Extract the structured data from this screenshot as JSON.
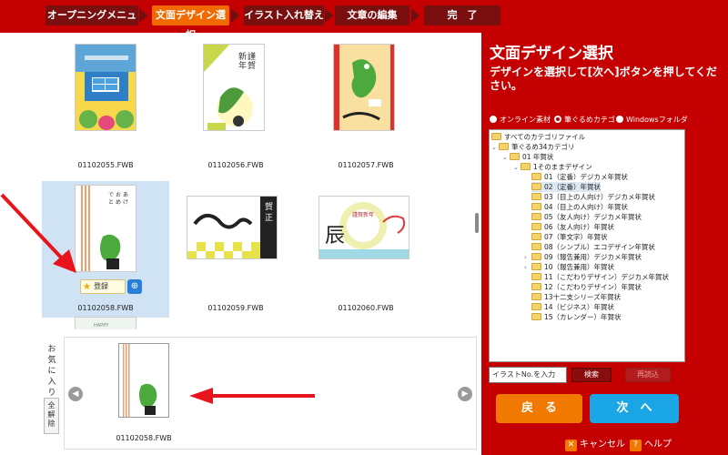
{
  "steps": [
    {
      "label": "オープニングメニュー",
      "active": false
    },
    {
      "label": "文面デザイン選択",
      "active": true
    },
    {
      "label": "イラスト入れ替え",
      "active": false
    },
    {
      "label": "文章の編集",
      "active": false
    },
    {
      "label": "完　了",
      "active": false
    }
  ],
  "gallery": {
    "items": [
      {
        "file": "01102055.FWB"
      },
      {
        "file": "01102056.FWB"
      },
      {
        "file": "01102057.FWB"
      },
      {
        "file": "01102058.FWB"
      },
      {
        "file": "01102059.FWB"
      },
      {
        "file": "01102060.FWB"
      }
    ],
    "register_label": "登録",
    "art_text": {
      "card2": "謹賀新年",
      "card5": "賀正",
      "card6_title": "謹賀新年",
      "card6_kanji": "辰",
      "card7_top": "HAPPY"
    }
  },
  "favorites": {
    "label": "お気に入り",
    "clear_label": "全解除",
    "items": [
      {
        "file": "01102058.FWB"
      }
    ]
  },
  "panel": {
    "title": "文面デザイン選択",
    "description": "デザインを選択して[次へ]ボタンを押してください。",
    "sources": [
      {
        "label": "オンライン素材",
        "selected": false
      },
      {
        "label": "筆ぐるめカテゴリ",
        "selected": true
      },
      {
        "label": "Windowsフォルダ",
        "selected": false
      }
    ],
    "tree": [
      {
        "label": "すべてのカテゴリファイル",
        "level": 0,
        "toggle": ""
      },
      {
        "label": "筆ぐるめ34カテゴリ",
        "level": 0,
        "toggle": "v"
      },
      {
        "label": "01 年賀状",
        "level": 1,
        "toggle": "v"
      },
      {
        "label": "1そのままデザイン",
        "level": 2,
        "toggle": "v"
      },
      {
        "label": "01（定番）デジカメ年賀状",
        "level": 3,
        "toggle": ""
      },
      {
        "label": "02（定番）年賀状",
        "level": 3,
        "toggle": "",
        "selected": true
      },
      {
        "label": "03（目上の人向け）デジカメ年賀状",
        "level": 3,
        "toggle": ""
      },
      {
        "label": "04（目上の人向け）年賀状",
        "level": 3,
        "toggle": ""
      },
      {
        "label": "05（友人向け）デジカメ年賀状",
        "level": 3,
        "toggle": ""
      },
      {
        "label": "06（友人向け）年賀状",
        "level": 3,
        "toggle": ""
      },
      {
        "label": "07（筆文字）年賀状",
        "level": 3,
        "toggle": ""
      },
      {
        "label": "08（シンプル）エコデザイン年賀状",
        "level": 3,
        "toggle": ""
      },
      {
        "label": "09（報告兼用）デジカメ年賀状",
        "level": 3,
        "toggle": ">"
      },
      {
        "label": "10（報告兼用）年賀状",
        "level": 3,
        "toggle": ">"
      },
      {
        "label": "11（こだわりデザイン）デジカメ年賀状",
        "level": 3,
        "toggle": ""
      },
      {
        "label": "12（こだわりデザイン）年賀状",
        "level": 3,
        "toggle": ""
      },
      {
        "label": "13十二支シリーズ年賀状",
        "level": 3,
        "toggle": ""
      },
      {
        "label": "14（ビジネス）年賀状",
        "level": 3,
        "toggle": ""
      },
      {
        "label": "15（カレンダー）年賀状",
        "level": 3,
        "toggle": ""
      }
    ],
    "search_placeholder": "イラストNo.を入力",
    "search_label": "検索",
    "reload_label": "再読込",
    "back_label": "戻　る",
    "next_label": "次　へ",
    "cancel_label": "キャンセル",
    "help_label": "ヘルプ"
  },
  "colors": {
    "brand_red": "#c40000",
    "active_step": "#f06a00",
    "back_orange": "#f27900",
    "next_blue": "#1aa6e4",
    "arrow_red": "#e8141b"
  }
}
